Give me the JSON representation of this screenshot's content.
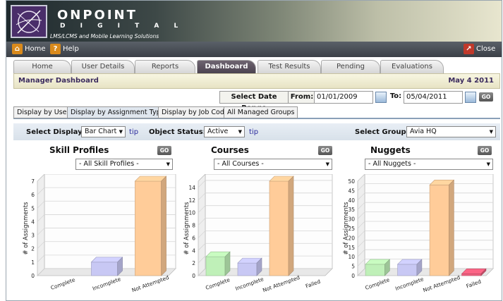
{
  "brand": {
    "name": "ONPOINT",
    "sub": "D I G I T A L",
    "tagline": "LMS/LCMS and Mobile Learning Solutions"
  },
  "toolbar": {
    "home_label": "Home",
    "help_label": "Help",
    "close_label": "Close"
  },
  "tabs": [
    {
      "label": "Home"
    },
    {
      "label": "User Details"
    },
    {
      "label": "Reports"
    },
    {
      "label": "Dashboard"
    },
    {
      "label": "Test Results"
    },
    {
      "label": "Pending"
    },
    {
      "label": "Evaluations"
    }
  ],
  "manager_bar": {
    "title": "Manager Dashboard",
    "date": "May 4 2011"
  },
  "date_range": {
    "label": "Select Date Range",
    "from_label": "From:",
    "from_value": "01/01/2009",
    "to_label": "To:",
    "to_value": "05/04/2011",
    "go_label": "GO"
  },
  "sub_tabs": [
    {
      "label": "Display by User"
    },
    {
      "label": "Display by Assignment Type"
    },
    {
      "label": "Display by Job Code"
    },
    {
      "label": "All Managed Groups"
    }
  ],
  "filters": {
    "display_label": "Select Display:",
    "display_value": "Bar Chart",
    "tip": "tip",
    "status_label": "Object Status:",
    "status_value": "Active",
    "group_label": "Select Group:",
    "group_value": "Avia HQ"
  },
  "panels": [
    {
      "title": "Skill Profiles",
      "go": "GO",
      "dropdown": "- All Skill Profiles -"
    },
    {
      "title": "Courses",
      "go": "GO",
      "dropdown": "- All Courses -"
    },
    {
      "title": "Nuggets",
      "go": "GO",
      "dropdown": "- All Nuggets -"
    }
  ],
  "colors": {
    "complete": "#bff0b8",
    "incomplete": "#c8c8f4",
    "not_attempted": "#ffcc99",
    "failed": "#f06080"
  },
  "chart_data": [
    {
      "type": "bar",
      "ylabel": "# of Assignments",
      "ylim": [
        0,
        7
      ],
      "yticks": [
        0,
        1,
        2,
        3,
        4,
        5,
        6,
        7
      ],
      "categories": [
        "Complete",
        "Incomplete",
        "Not Attempted"
      ],
      "values": [
        0,
        1,
        7
      ],
      "color_keys": [
        "complete",
        "incomplete",
        "not_attempted"
      ]
    },
    {
      "type": "bar",
      "ylabel": "# of Assignments",
      "ylim": [
        0,
        15
      ],
      "yticks": [
        0,
        2,
        4,
        6,
        8,
        10,
        12,
        14
      ],
      "categories": [
        "Complete",
        "Incomplete",
        "Not Attempted",
        "Failed"
      ],
      "values": [
        3,
        2,
        15,
        0
      ],
      "color_keys": [
        "complete",
        "incomplete",
        "not_attempted",
        "failed"
      ]
    },
    {
      "type": "bar",
      "ylabel": "# of Assignments",
      "ylim": [
        0,
        50
      ],
      "yticks": [
        0,
        5,
        10,
        15,
        20,
        25,
        30,
        35,
        40,
        45,
        50
      ],
      "categories": [
        "Complete",
        "Incomplete",
        "Not Attempted",
        "Failed"
      ],
      "values": [
        6,
        6,
        48,
        1
      ],
      "color_keys": [
        "complete",
        "incomplete",
        "not_attempted",
        "failed"
      ]
    }
  ]
}
